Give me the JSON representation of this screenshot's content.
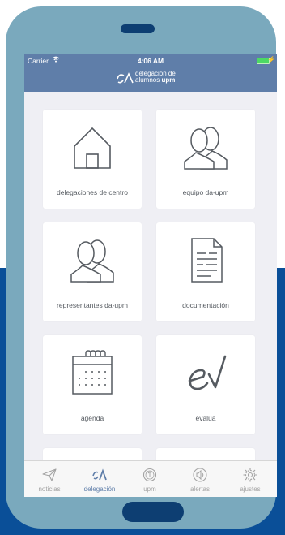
{
  "status": {
    "carrier": "Carrier",
    "time": "4:06 AM"
  },
  "header": {
    "brand_line1": "delegación de",
    "brand_line2_a": "alumnos",
    "brand_line2_b": "upm"
  },
  "tiles": [
    {
      "label": "delegaciones de centro",
      "icon": "house-icon"
    },
    {
      "label": "equipo da-upm",
      "icon": "people-icon"
    },
    {
      "label": "representantes da-upm",
      "icon": "people-icon"
    },
    {
      "label": "documentación",
      "icon": "document-icon"
    },
    {
      "label": "agenda",
      "icon": "calendar-icon"
    },
    {
      "label": "evalúa",
      "icon": "evalua-icon"
    }
  ],
  "tabbar": {
    "items": [
      {
        "label": "noticias",
        "icon": "paper-plane-icon",
        "active": false
      },
      {
        "label": "delegación",
        "icon": "da-logo-icon",
        "active": true
      },
      {
        "label": "upm",
        "icon": "upm-seal-icon",
        "active": false
      },
      {
        "label": "alertas",
        "icon": "speaker-icon",
        "active": false
      },
      {
        "label": "ajustes",
        "icon": "gear-icon",
        "active": false
      }
    ]
  },
  "colors": {
    "navbar": "#5f7ea9",
    "phone_body": "#7aa9bd",
    "phone_details": "#0d3e72",
    "background_block": "#0a4f98",
    "screen_bg": "#efeff4",
    "icon_stroke": "#555a60",
    "tab_active": "#5f7ea9",
    "tab_inactive": "#a3a3a3"
  }
}
